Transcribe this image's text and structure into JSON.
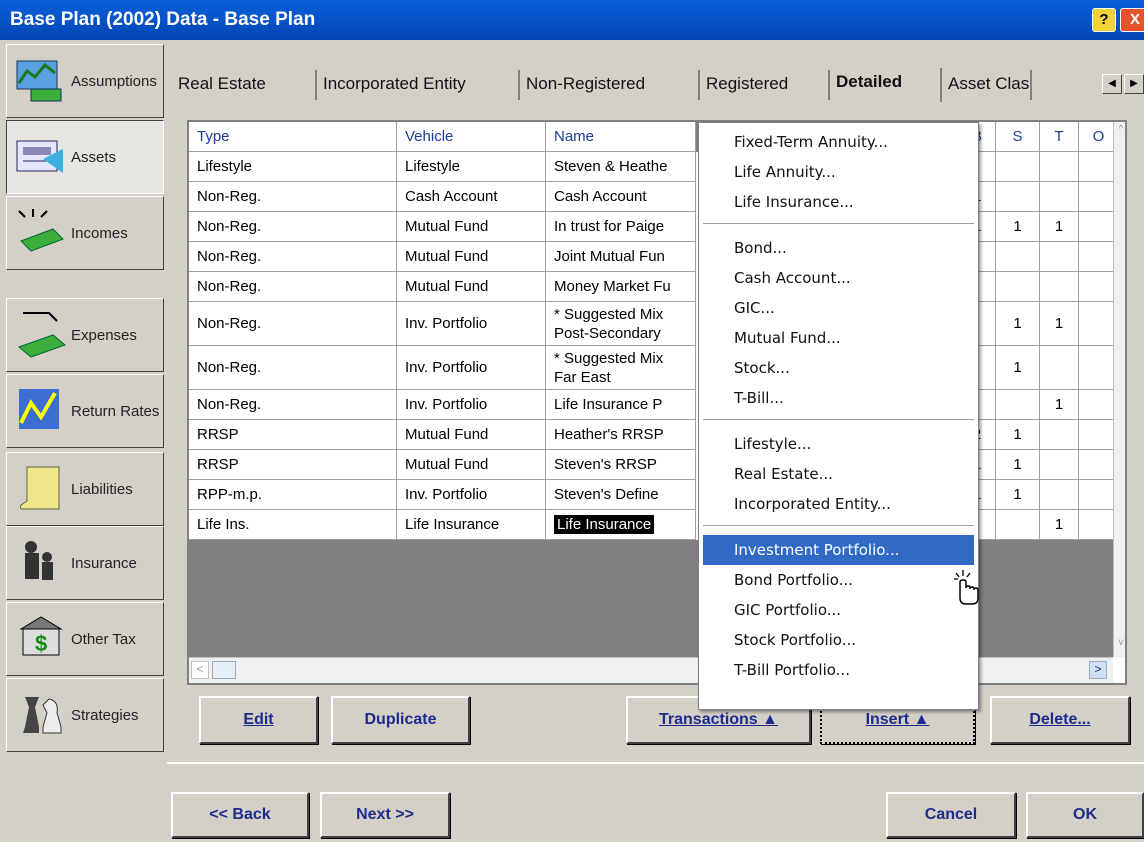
{
  "window": {
    "title": "Base Plan (2002) Data - Base Plan",
    "help": "?",
    "close": "X"
  },
  "sidebar": [
    {
      "label": "Assumptions",
      "icon": "assumptions-icon"
    },
    {
      "label": "Assets",
      "icon": "assets-icon",
      "selected": true
    },
    {
      "label": "Incomes",
      "icon": "incomes-icon"
    },
    {
      "label": "Expenses",
      "icon": "expenses-icon"
    },
    {
      "label": "Return Rates",
      "icon": "return-rates-icon"
    },
    {
      "label": "Liabilities",
      "icon": "liabilities-icon"
    },
    {
      "label": "Insurance",
      "icon": "insurance-icon"
    },
    {
      "label": "Other Tax",
      "icon": "other-tax-icon"
    },
    {
      "label": "Strategies",
      "icon": "strategies-icon"
    }
  ],
  "tabs": [
    "Real Estate",
    "Incorporated Entity",
    "Non-Registered",
    "Registered",
    "Detailed",
    "Asset Class"
  ],
  "selected_tab": "Detailed",
  "grid": {
    "headers": [
      "Type",
      "Vehicle",
      "Name",
      "B",
      "S",
      "T",
      "O"
    ],
    "rows": [
      {
        "type": "Lifestyle",
        "vehicle": "Lifestyle",
        "name": "Steven & Heathe",
        "b": "",
        "s": "",
        "t": ""
      },
      {
        "type": "Non-Reg.",
        "vehicle": "Cash Account",
        "name": "Cash Account",
        "b": "1",
        "s": "",
        "t": ""
      },
      {
        "type": "Non-Reg.",
        "vehicle": "Mutual Fund",
        "name": "In trust for Paige",
        "b": "1",
        "s": "1",
        "t": "1"
      },
      {
        "type": "Non-Reg.",
        "vehicle": "Mutual Fund",
        "name": "Joint Mutual Fun",
        "b": "",
        "s": "",
        "t": ""
      },
      {
        "type": "Non-Reg.",
        "vehicle": "Mutual Fund",
        "name": "Money Market Fu",
        "b": "",
        "s": "",
        "t": ""
      },
      {
        "type": "Non-Reg.",
        "vehicle": "Inv. Portfolio",
        "name": "* Suggested Mix\nPost-Secondary",
        "b": "",
        "s": "1",
        "t": "1"
      },
      {
        "type": "Non-Reg.",
        "vehicle": "Inv. Portfolio",
        "name": "* Suggested Mix\nFar East",
        "b": "",
        "s": "1",
        "t": ""
      },
      {
        "type": "Non-Reg.",
        "vehicle": "Inv. Portfolio",
        "name": "Life Insurance P",
        "b": "",
        "s": "",
        "t": "1"
      },
      {
        "type": "RRSP",
        "vehicle": "Mutual Fund",
        "name": "Heather's RRSP",
        "b": "2",
        "s": "1",
        "t": ""
      },
      {
        "type": "RRSP",
        "vehicle": "Mutual Fund",
        "name": "Steven's RRSP",
        "b": "1",
        "s": "1",
        "t": ""
      },
      {
        "type": "RPP-m.p.",
        "vehicle": "Inv. Portfolio",
        "name": "Steven's Define",
        "b": "1",
        "s": "1",
        "t": ""
      },
      {
        "type": "Life Ins.",
        "vehicle": "Life Insurance",
        "name": "Life Insurance",
        "b": "",
        "s": "",
        "t": "1",
        "selected": true
      }
    ]
  },
  "actions": {
    "edit": "Edit",
    "duplicate": "Duplicate",
    "transactions": "Transactions ▲",
    "insert": "Insert ▲",
    "delete": "Delete..."
  },
  "nav": {
    "back": "<< Back",
    "next": "Next >>",
    "cancel": "Cancel",
    "ok": "OK"
  },
  "menu": {
    "groups": [
      [
        "Fixed-Term Annuity...",
        "Life Annuity...",
        "Life Insurance..."
      ],
      [
        "Bond...",
        "Cash Account...",
        "GIC...",
        "Mutual Fund...",
        "Stock...",
        "T-Bill..."
      ],
      [
        "Lifestyle...",
        "Real Estate...",
        "Incorporated Entity..."
      ],
      [
        "Investment Portfolio...",
        "Bond Portfolio...",
        "GIC Portfolio...",
        "Stock Portfolio...",
        "T-Bill Portfolio..."
      ]
    ],
    "highlighted": "Investment Portfolio..."
  },
  "colors": {
    "titlebar": "#0653c8",
    "menu_highlight": "#316ac5",
    "header_text": "#1c3b94"
  }
}
